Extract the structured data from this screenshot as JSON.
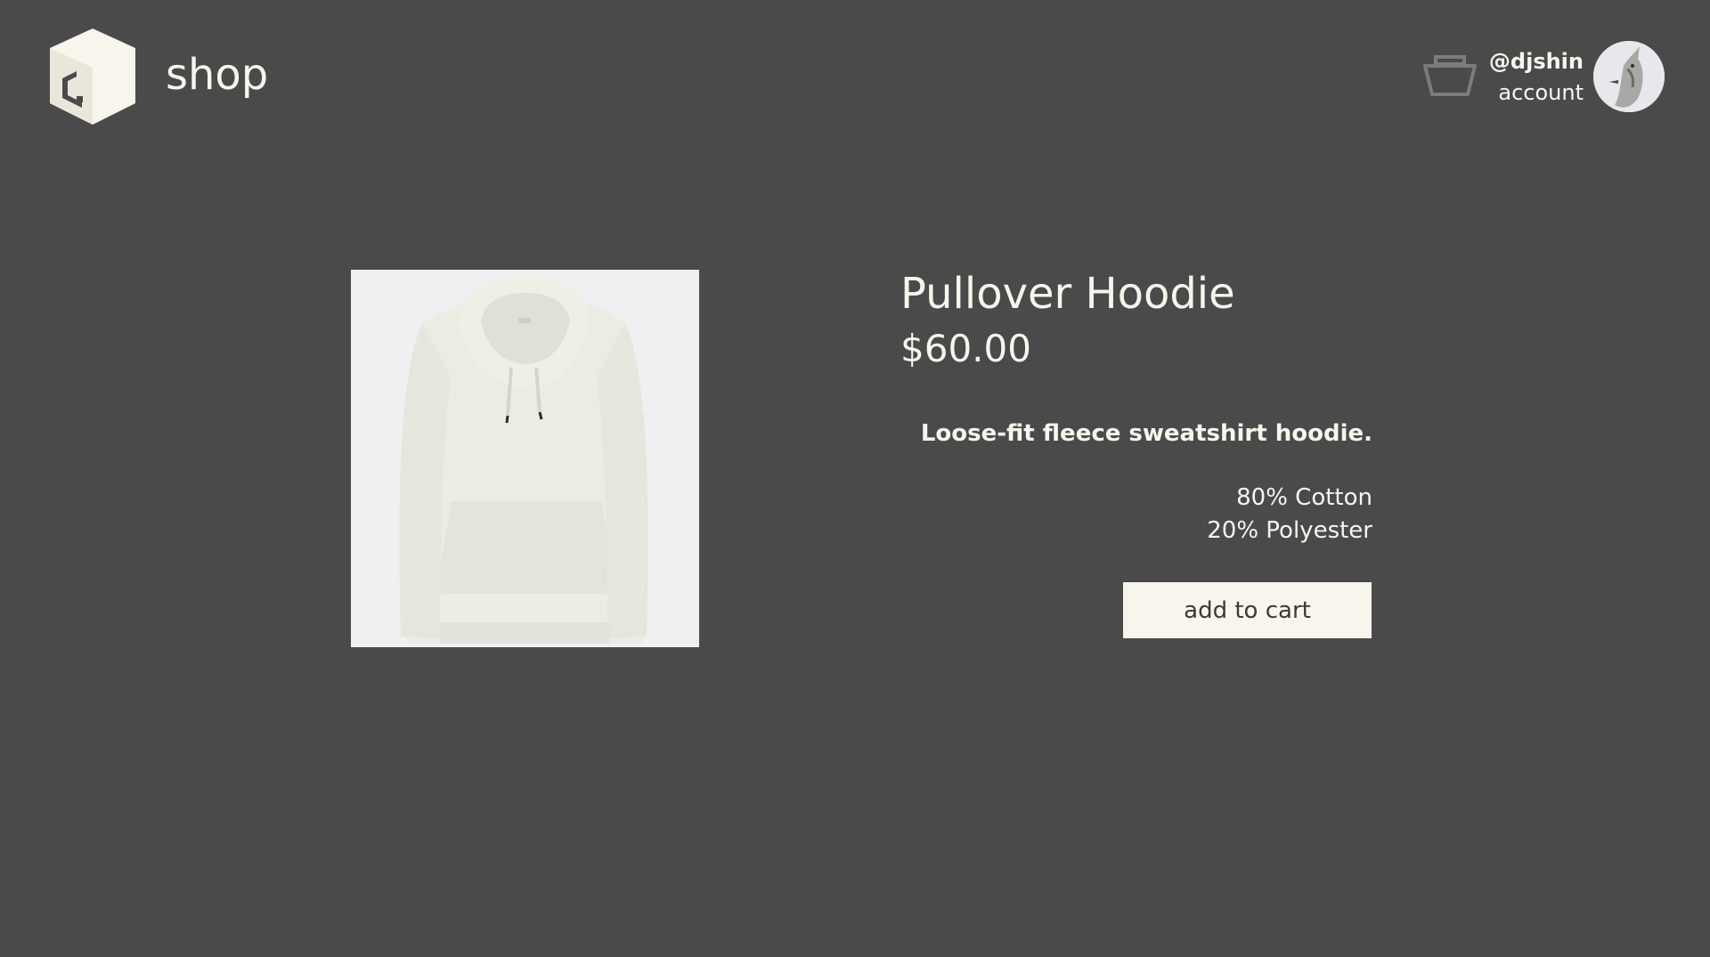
{
  "header": {
    "brand": "shop",
    "logo_letter": "C.",
    "account": {
      "handle": "@djshin",
      "label": "account"
    }
  },
  "product": {
    "title": "Pullover Hoodie",
    "price": "$60.00",
    "description": "Loose-fit  fleece sweatshirt hoodie.",
    "materials": [
      "80% Cotton",
      "20% Polyester"
    ],
    "add_to_cart_label": "add to cart"
  },
  "colors": {
    "background": "#4a4a4a",
    "foreground": "#f7f5ec",
    "button_text": "#3a3a3a"
  },
  "icons": {
    "logo": "box-logo-icon",
    "cart": "basket-icon",
    "avatar": "bird-avatar"
  }
}
